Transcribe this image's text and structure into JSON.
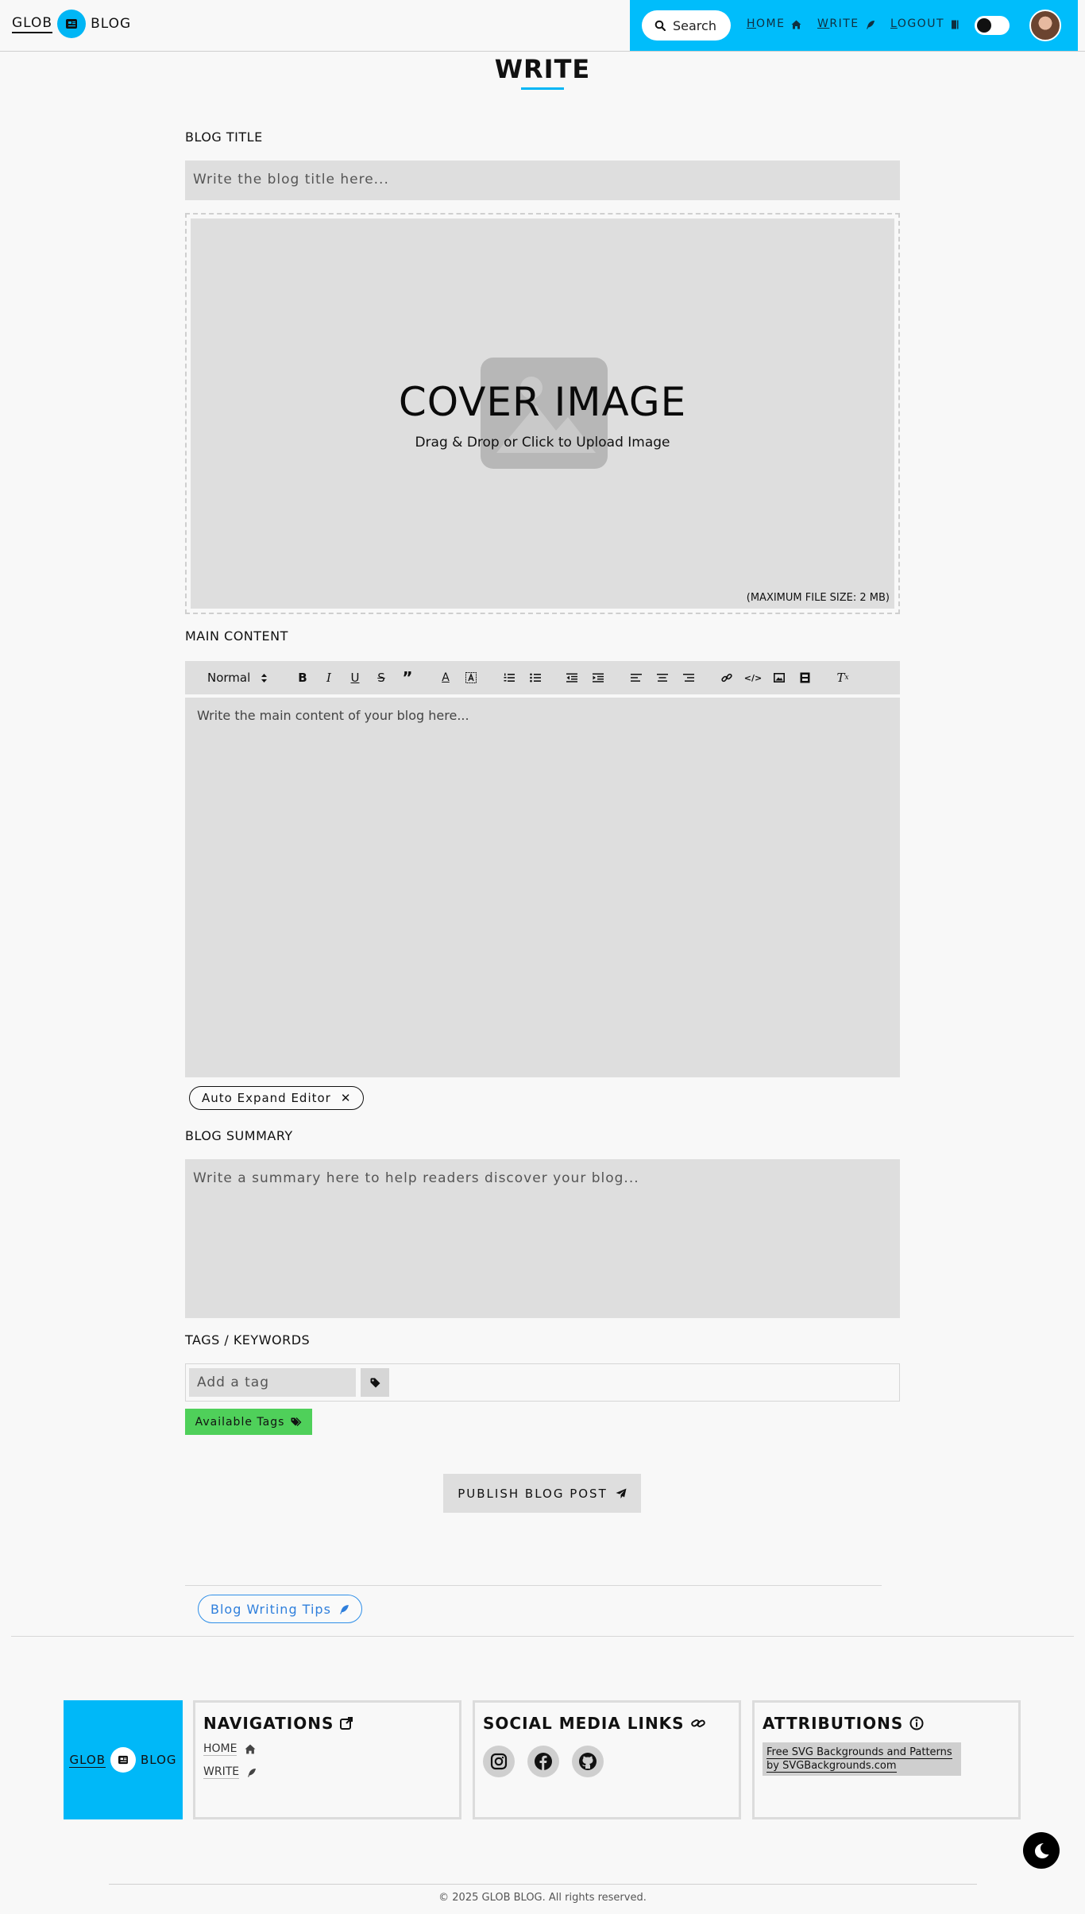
{
  "header": {
    "logo_left": "GLOB",
    "logo_right": "BLOG",
    "search_label": "Search",
    "nav": {
      "home": "HOME",
      "write": "WRITE",
      "logout": "LOGOUT"
    },
    "accent_color": "#00bdfb"
  },
  "page": {
    "title": "WRITE"
  },
  "form": {
    "blog_title_label": "BLOG TITLE",
    "blog_title_placeholder": "Write the blog title here...",
    "cover": {
      "title": "COVER IMAGE",
      "subtitle": "Drag & Drop or Click to Upload Image",
      "max_size": "(MAXIMUM FILE SIZE: 2 MB)"
    },
    "main_content_label": "MAIN CONTENT",
    "toolbar": {
      "heading_select": "Normal"
    },
    "editor_placeholder": "Write the main content of your blog here...",
    "auto_expand_chip": "Auto Expand Editor",
    "summary_label": "BLOG SUMMARY",
    "summary_placeholder": "Write a summary here to help readers discover your blog...",
    "tags_label": "TAGS / KEYWORDS",
    "tag_placeholder": "Add a tag",
    "available_tags": "Available Tags",
    "publish": "PUBLISH BLOG POST",
    "tips": "Blog Writing Tips"
  },
  "footer": {
    "logo_left": "GLOB",
    "logo_right": "BLOG",
    "navigations_title": "NAVIGATIONS",
    "nav_home": "HOME",
    "nav_write": "WRITE",
    "social_title": "SOCIAL MEDIA LINKS",
    "attributions_title": "ATTRIBUTIONS",
    "attribution_text": "Free SVG Backgrounds and Patterns by SVGBackgrounds.com",
    "copyright": "© 2025 GLOB BLOG. All rights reserved."
  }
}
